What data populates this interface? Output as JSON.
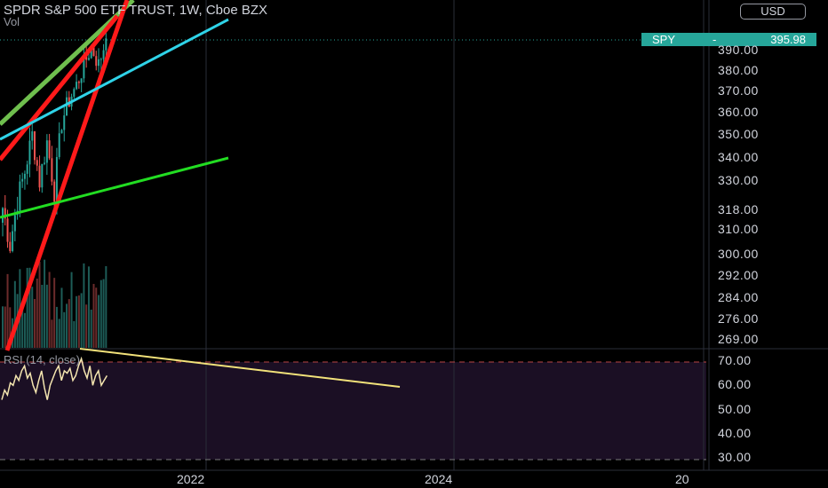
{
  "header": {
    "title": "SPDR S&P 500 ETF TRUST, 1W, Cboe BZX",
    "vol_label": "Vol",
    "currency": "USD"
  },
  "price_tag": {
    "symbol": "SPY",
    "value": "395.98"
  },
  "rsi": {
    "label": "RSI (14, close)"
  },
  "colors": {
    "background": "#000000",
    "up": "#26a69a",
    "down": "#ef5350",
    "rsi_line": "#f5e6b0",
    "rsi_band": "#1b0f24",
    "trend_red": "#ff1a1a",
    "trend_cyan": "#2fd3e8",
    "trend_green": "#22dd22",
    "trend_olive": "#6fbf4e",
    "trend_yellow": "#f2e27a"
  },
  "chart_data": [
    {
      "type": "candlestick",
      "title": "SPDR S&P 500 ETF TRUST, 1W, Cboe BZX",
      "y_axis_ticks": [
        "390.00",
        "380.00",
        "370.00",
        "360.00",
        "350.00",
        "340.00",
        "330.00",
        "318.00",
        "310.00",
        "300.00",
        "292.00",
        "284.00",
        "276.00",
        "269.00"
      ],
      "x_axis_ticks": [
        "2022",
        "2024",
        "20"
      ],
      "last_price": 395.98,
      "close_series": [
        {
          "date": "2020-06-05",
          "close": 319
        },
        {
          "date": "2020-06-26",
          "close": 304
        },
        {
          "date": "2020-07-17",
          "close": 322
        },
        {
          "date": "2020-08-07",
          "close": 334
        },
        {
          "date": "2020-08-28",
          "close": 350
        },
        {
          "date": "2020-09-18",
          "close": 330
        },
        {
          "date": "2020-10-09",
          "close": 347
        },
        {
          "date": "2020-10-30",
          "close": 326
        },
        {
          "date": "2020-11-20",
          "close": 356
        },
        {
          "date": "2020-12-11",
          "close": 366
        },
        {
          "date": "2021-01-01",
          "close": 373
        },
        {
          "date": "2021-01-22",
          "close": 383
        },
        {
          "date": "2021-02-12",
          "close": 392
        },
        {
          "date": "2021-03-05",
          "close": 383
        },
        {
          "date": "2021-03-26",
          "close": 396
        }
      ],
      "trendlines": [
        {
          "name": "rising-wedge-lower",
          "color": "trend_red"
        },
        {
          "name": "rising-wedge-upper",
          "color": "trend_red"
        },
        {
          "name": "channel-cyan",
          "color": "trend_cyan"
        },
        {
          "name": "support-green",
          "color": "trend_green"
        },
        {
          "name": "resistance-olive",
          "color": "trend_olive"
        }
      ]
    },
    {
      "type": "line",
      "title": "RSI (14, close)",
      "y_axis_ticks": [
        "70.00",
        "60.00",
        "50.00",
        "40.00",
        "30.00"
      ],
      "ylim": [
        30,
        70
      ],
      "bands": [
        30,
        70
      ],
      "series": [
        {
          "values": [
            54,
            58,
            56,
            61,
            60,
            64,
            62,
            66,
            68,
            63,
            65,
            60,
            57,
            62,
            66,
            59,
            54,
            60,
            63,
            66,
            68,
            62,
            66,
            65,
            67,
            62,
            64,
            68,
            71,
            66,
            63,
            68,
            60,
            64,
            66,
            60,
            62,
            64
          ]
        }
      ],
      "divergence_line": {
        "name": "rsi-divergence-trendline",
        "color": "trend_yellow"
      }
    }
  ]
}
